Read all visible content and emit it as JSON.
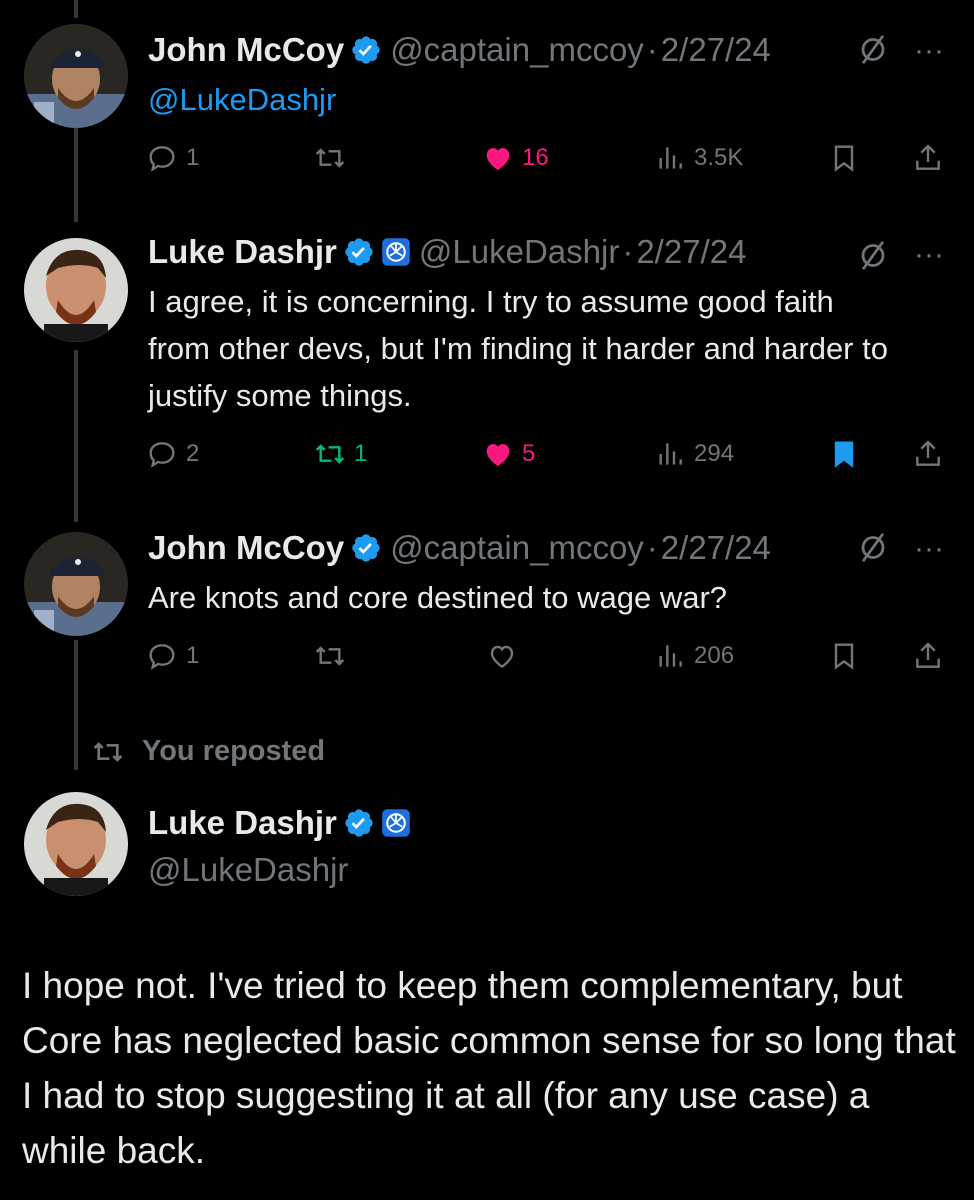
{
  "colors": {
    "background": "#000000",
    "text": "#e7e9ea",
    "muted": "#71767b",
    "link": "#1d9bf0",
    "like": "#f91880",
    "repost": "#00ba7c",
    "verified": "#1d9bf0"
  },
  "tweets": [
    {
      "name": "John McCoy",
      "handle": "@captain_mccoy",
      "separator": "·",
      "date": "2/27/24",
      "mention": "@LukeDashjr",
      "text": "",
      "replies": "1",
      "reposts": "",
      "likes": "16",
      "views": "3.5K",
      "liked": true,
      "reposted": false,
      "bookmarked": false
    },
    {
      "name": "Luke Dashjr",
      "handle": "@LukeDashjr",
      "separator": "·",
      "date": "2/27/24",
      "mention": "",
      "text": "I agree, it is concerning. I try to assume good faith from other devs, but I'm finding it harder and harder to justify some things.",
      "replies": "2",
      "reposts": "1",
      "likes": "5",
      "views": "294",
      "liked": true,
      "reposted": true,
      "bookmarked": true
    },
    {
      "name": "John McCoy",
      "handle": "@captain_mccoy",
      "separator": "·",
      "date": "2/27/24",
      "mention": "",
      "text": "Are knots and core destined to wage war?",
      "replies": "1",
      "reposts": "",
      "likes": "",
      "views": "206",
      "liked": false,
      "reposted": false,
      "bookmarked": false
    }
  ],
  "repost_banner": "You reposted",
  "main_tweet": {
    "name": "Luke Dashjr",
    "handle": "@LukeDashjr",
    "text": "I hope not. I've tried to keep them complementary, but Core has neglected basic common sense for so long that I had to stop suggesting it at all (for any use case) a while back."
  },
  "icons": [
    "reply-icon",
    "repost-icon",
    "like-icon",
    "views-icon",
    "bookmark-icon",
    "share-icon",
    "verified-badge-icon",
    "affiliate-badge-icon",
    "grok-icon",
    "more-icon"
  ]
}
